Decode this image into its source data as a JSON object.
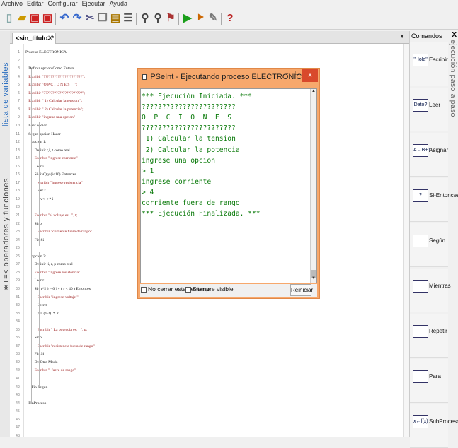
{
  "menu": {
    "items": [
      "Archivo",
      "Editar",
      "Configurar",
      "Ejecutar",
      "Ayuda"
    ]
  },
  "toolbar": {
    "icons": [
      "new-file-icon",
      "open-file-icon",
      "save-icon",
      "save-as-icon",
      "undo-icon",
      "redo-icon",
      "cut-icon",
      "copy-icon",
      "paste-icon",
      "indent-icon",
      "find-icon",
      "replace-icon",
      "find-next-icon",
      "run-icon",
      "step-icon",
      "diagram-icon",
      "help-icon"
    ]
  },
  "left_sidebar": {
    "label1": "lista de variables",
    "label2": "∗+=< operadores y funciones"
  },
  "editor": {
    "tab_label": "<sin_titulo>*",
    "tab_close": "X",
    "lines": [
      "Proceso ELECTRONICA",
      "",
      "   Definir opcion Como Entero",
      "   Escribir \"??????????????????????\";",
      "   Escribir \"O P C I O N E S     \";",
      "   Escribir \"??????????????????????\";",
      "   Escribir \" 1) Calcular la tension \";",
      "   Escribir \" 2) Calcular la potencia\";",
      "   Escribir \"ingrese una opcion\"",
      "   Leer opcion",
      "   Segun opcion Hacer",
      "      opcion 1:",
      "         Definir r,i, t como real",
      "         Escribir \"ingrese corriente\"",
      "         Leer i",
      "         Si (i>0) y (i<10) Entonces",
      "            escribir \"ingrese resistencia\"",
      "            leer r",
      "               v<- r * i",
      "",
      "         Escribir \"el voltaje es:  \", t;",
      "         Sino",
      "            Escribir \"corriente fuera de rango\"",
      "         Fin Si",
      "",
      "      opcion 2:",
      "         Definir  i, r, p como real",
      "         Escribir \"ingrese resistencia\"",
      "         Leer r",
      "         Si ( r^2 ) > 0 ) y ( r < 40 ) Entonces",
      "            Escribir \"ingrese voltaje \"",
      "            Leer t",
      "            p = (t^2)  *  r",
      "",
      "            Escribir \" La potencia es:   \", p;",
      "         Sino",
      "            Escribir \"resistencia fuera de rango\"",
      "         Fin Si",
      "         De Otro Modo",
      "         Escribir \"  fuera de rango\"",
      "",
      "      Fin Segun",
      "",
      "   FinProceso",
      "",
      "",
      "",
      ""
    ]
  },
  "commands_panel": {
    "title": "Comandos",
    "close": "X",
    "side_label": "ejecución paso a paso",
    "items": [
      {
        "icon_text": "\"Hola\"",
        "label": "Escribir"
      },
      {
        "icon_text": "Dato?",
        "label": "Leer"
      },
      {
        "icon_text": "A←B+1",
        "label": "Asignar"
      },
      {
        "icon_text": "? ",
        "label": "Si-Entonces"
      },
      {
        "icon_text": "",
        "label": "Según"
      },
      {
        "icon_text": "",
        "label": "Mientras"
      },
      {
        "icon_text": "",
        "label": "Repetir"
      },
      {
        "icon_text": "",
        "label": "Para"
      },
      {
        "icon_text": "x←f(x)",
        "label": "SubProceso"
      }
    ]
  },
  "run_window": {
    "title": "PSeInt - Ejecutando proceso ELECTRONICA",
    "min": "-",
    "max": "□",
    "close": "x",
    "output": [
      "*** Ejecución Iniciada. ***",
      "???????????????????????",
      "O  P  C  I  O  N  E  S",
      "???????????????????????",
      " 1) Calcular la tension",
      " 2) Calcular la potencia",
      "ingrese una opcion",
      "> 1",
      "ingrese corriente",
      "> 4",
      "corriente fuera de rango",
      "*** Ejecución Finalizada. ***"
    ],
    "chk1": "No cerrar esta ventana",
    "chk2": "Siempre visible",
    "restart": "Reiniciar"
  }
}
